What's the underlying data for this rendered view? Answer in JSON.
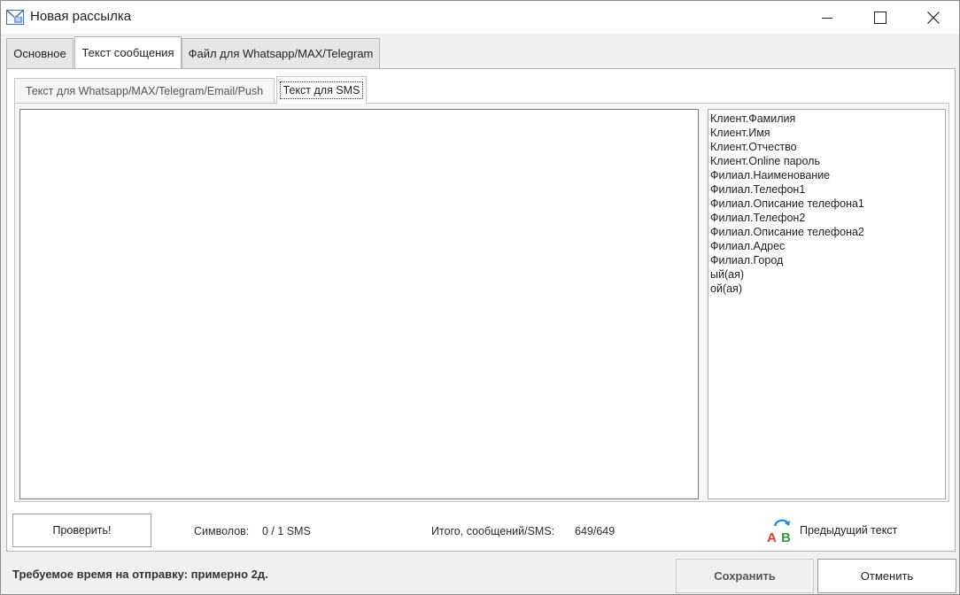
{
  "window": {
    "title": "Новая рассылка",
    "controls": {
      "minimize": "minimize-icon",
      "maximize": "maximize-icon",
      "close": "close-icon"
    }
  },
  "outer_tabs": [
    {
      "label": "Основное",
      "active": false
    },
    {
      "label": "Текст сообщения",
      "active": true
    },
    {
      "label": "Файл для Whatsapp/MAX/Telegram",
      "active": false
    }
  ],
  "inner_tabs": [
    {
      "label": "Текст для Whatsapp/MAX/Telegram/Email/Push",
      "active": false
    },
    {
      "label": "Текст для SMS",
      "active": true
    }
  ],
  "sms_text": {
    "value": ""
  },
  "variables": [
    "Клиент.Фамилия",
    "Клиент.Имя",
    "Клиент.Отчество",
    "Клиент.Online пароль",
    "Филиал.Наименование",
    "Филиал.Телефон1",
    "Филиал.Описание телефона1",
    "Филиал.Телефон2",
    "Филиал.Описание телефона2",
    "Филиал.Адрес",
    "Филиал.Город",
    "ый(ая)",
    "ой(ая)"
  ],
  "stats": {
    "check_button": "Проверить!",
    "chars_label": "Символов:",
    "chars_value": "0 / 1 SMS",
    "total_label": "Итого, сообщений/SMS:",
    "total_value": "649/649"
  },
  "prev_text": {
    "label": "Предыдущий текст",
    "icon": "ab-swap-icon"
  },
  "footer": {
    "time_text": "Требуемое время на отправку: примерно 2д.",
    "save_label": "Сохранить",
    "cancel_label": "Отменить"
  },
  "colors": {
    "icon_a": "#e53935",
    "icon_b": "#2e9e3f",
    "icon_arrow": "#1e88e5"
  }
}
